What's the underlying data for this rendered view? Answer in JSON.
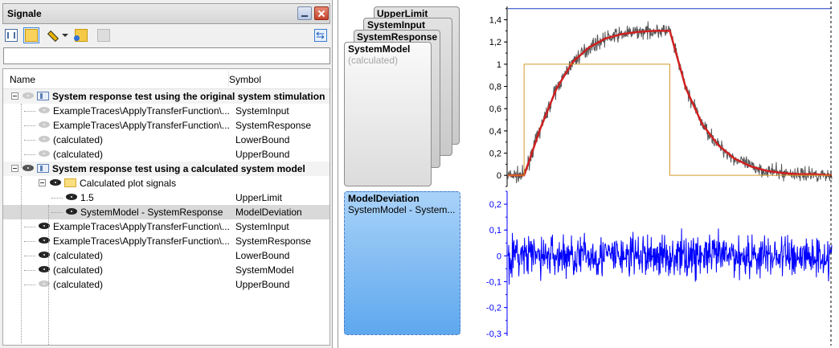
{
  "window": {
    "title": "Signale"
  },
  "toolbar": {
    "table_icon": "table-icon",
    "folder_icon": "folder-icon",
    "pencil_icon": "pencil-icon",
    "add_folder_icon": "add-folder-icon",
    "remove_icon": "remove-icon",
    "sync_icon": "sync-icon"
  },
  "search": {
    "value": "",
    "placeholder": ""
  },
  "tree": {
    "columns": [
      "Name",
      "Symbol"
    ],
    "rows": [
      {
        "name": "System response test using the original system stimulation",
        "symbol": ""
      },
      {
        "name": "ExampleTraces\\ApplyTransferFunction\\...",
        "symbol": "SystemInput"
      },
      {
        "name": "ExampleTraces\\ApplyTransferFunction\\...",
        "symbol": "SystemResponse"
      },
      {
        "name": "(calculated)",
        "symbol": "LowerBound"
      },
      {
        "name": "(calculated)",
        "symbol": "UpperBound"
      },
      {
        "name": "System response test using a calculated system model",
        "symbol": ""
      },
      {
        "name": "Calculated plot signals",
        "symbol": ""
      },
      {
        "name": "1.5",
        "symbol": "UpperLimit"
      },
      {
        "name": "SystemModel - SystemResponse",
        "symbol": "ModelDeviation"
      },
      {
        "name": "ExampleTraces\\ApplyTransferFunction\\...",
        "symbol": "SystemInput"
      },
      {
        "name": "ExampleTraces\\ApplyTransferFunction\\...",
        "symbol": "SystemResponse"
      },
      {
        "name": "(calculated)",
        "symbol": "LowerBound"
      },
      {
        "name": "(calculated)",
        "symbol": "SystemModel"
      },
      {
        "name": "(calculated)",
        "symbol": "UpperBound"
      }
    ]
  },
  "cards": {
    "stack": [
      "UpperLimit",
      "SystemInput",
      "SystemResponse"
    ],
    "model": {
      "name": "SystemModel",
      "sub": "(calculated)"
    },
    "deviation": {
      "name": "ModelDeviation",
      "sub": "SystemModel - System..."
    }
  },
  "chart_data": [
    {
      "type": "line",
      "ylim": [
        -0.1,
        1.52
      ],
      "yticks": [
        "1,4",
        "1,2",
        "1",
        "0,8",
        "0,6",
        "0,4",
        "0,2",
        "0"
      ],
      "xlim": [
        0,
        400
      ],
      "series": [
        {
          "name": "SystemResponse",
          "color": "#555555",
          "x": [
            0,
            20,
            40,
            60,
            80,
            100,
            120,
            140,
            160,
            180,
            200,
            220,
            240,
            260,
            280,
            300,
            320,
            340,
            360,
            380,
            400
          ],
          "values": [
            0,
            0,
            0.42,
            0.78,
            1.02,
            1.15,
            1.23,
            1.27,
            1.29,
            1.3,
            1.3,
            0.78,
            0.46,
            0.27,
            0.15,
            0.08,
            0.04,
            0.02,
            0.01,
            0.01,
            0.0
          ]
        },
        {
          "name": "SystemModel",
          "color": "#d02020",
          "x": [
            0,
            20,
            40,
            60,
            80,
            100,
            120,
            140,
            160,
            180,
            200,
            220,
            240,
            260,
            280,
            300,
            320,
            340,
            360,
            380,
            400
          ],
          "values": [
            0,
            0,
            0.42,
            0.78,
            1.02,
            1.15,
            1.23,
            1.27,
            1.29,
            1.3,
            1.3,
            0.78,
            0.46,
            0.27,
            0.15,
            0.08,
            0.04,
            0.02,
            0.01,
            0.01,
            0.0
          ]
        },
        {
          "name": "SystemInput",
          "color": "#d49a2a",
          "x": [
            0,
            20,
            20,
            200,
            200,
            400
          ],
          "values": [
            0,
            0,
            1,
            1,
            0,
            0
          ]
        },
        {
          "name": "UpperLimit",
          "color": "#1f3ec8",
          "x": [
            0,
            400
          ],
          "values": [
            1.5,
            1.5
          ]
        }
      ]
    },
    {
      "type": "line",
      "ylim": [
        -0.31,
        0.25
      ],
      "yticks": [
        "0,2",
        "0,1",
        "0",
        "-0,1",
        "-0,2",
        "-0,3"
      ],
      "xlim": [
        0,
        400
      ],
      "series": [
        {
          "name": "ModelDeviation",
          "color": "#0000ff",
          "x": [
            0,
            400
          ],
          "values": [
            0,
            0
          ]
        }
      ]
    }
  ]
}
